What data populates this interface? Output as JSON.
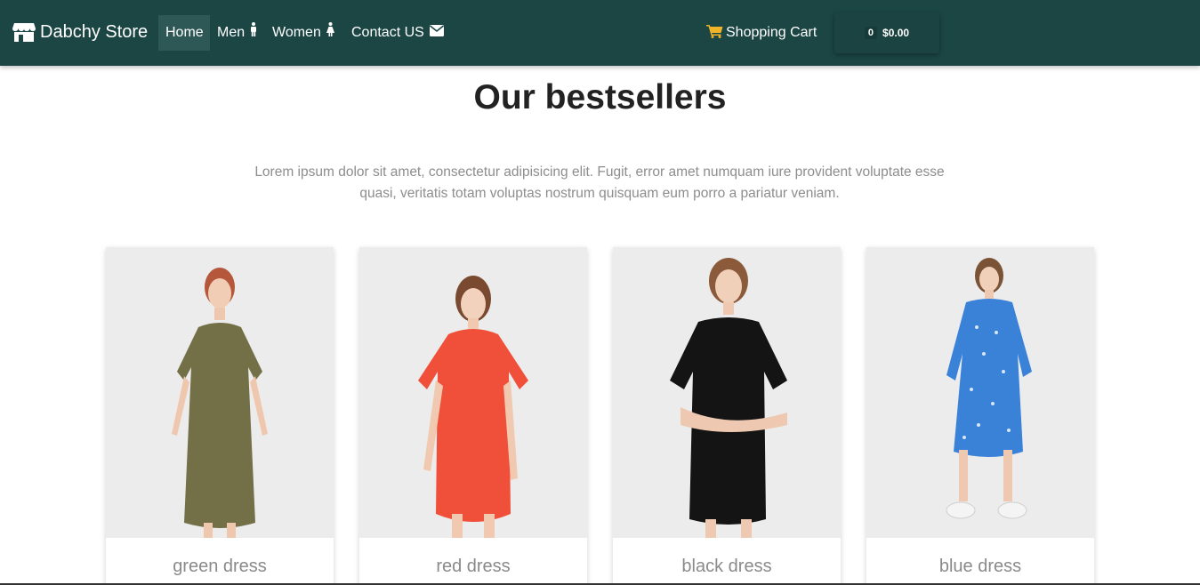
{
  "brand": {
    "name": "Dabchy Store",
    "icon": "store-icon"
  },
  "nav": {
    "home": "Home",
    "men": "Men",
    "women": "Women",
    "contact": "Contact US"
  },
  "cart": {
    "label": "Shopping Cart",
    "count": "0",
    "total": "$0.00"
  },
  "colors": {
    "navbar": "#1b4644",
    "accent": "#f0b429"
  },
  "main": {
    "title": "Our bestsellers",
    "lead": "Lorem ipsum dolor sit amet, consectetur adipisicing elit. Fugit, error amet numquam iure provident voluptate esse quasi, veritatis totam voluptas nostrum quisquam eum porro a pariatur veniam."
  },
  "products": [
    {
      "name": "green dress",
      "color": "#736f46"
    },
    {
      "name": "red dress",
      "color": "#f04f3a"
    },
    {
      "name": "black dress",
      "color": "#141414"
    },
    {
      "name": "blue dress",
      "color": "#3a82d8"
    }
  ]
}
